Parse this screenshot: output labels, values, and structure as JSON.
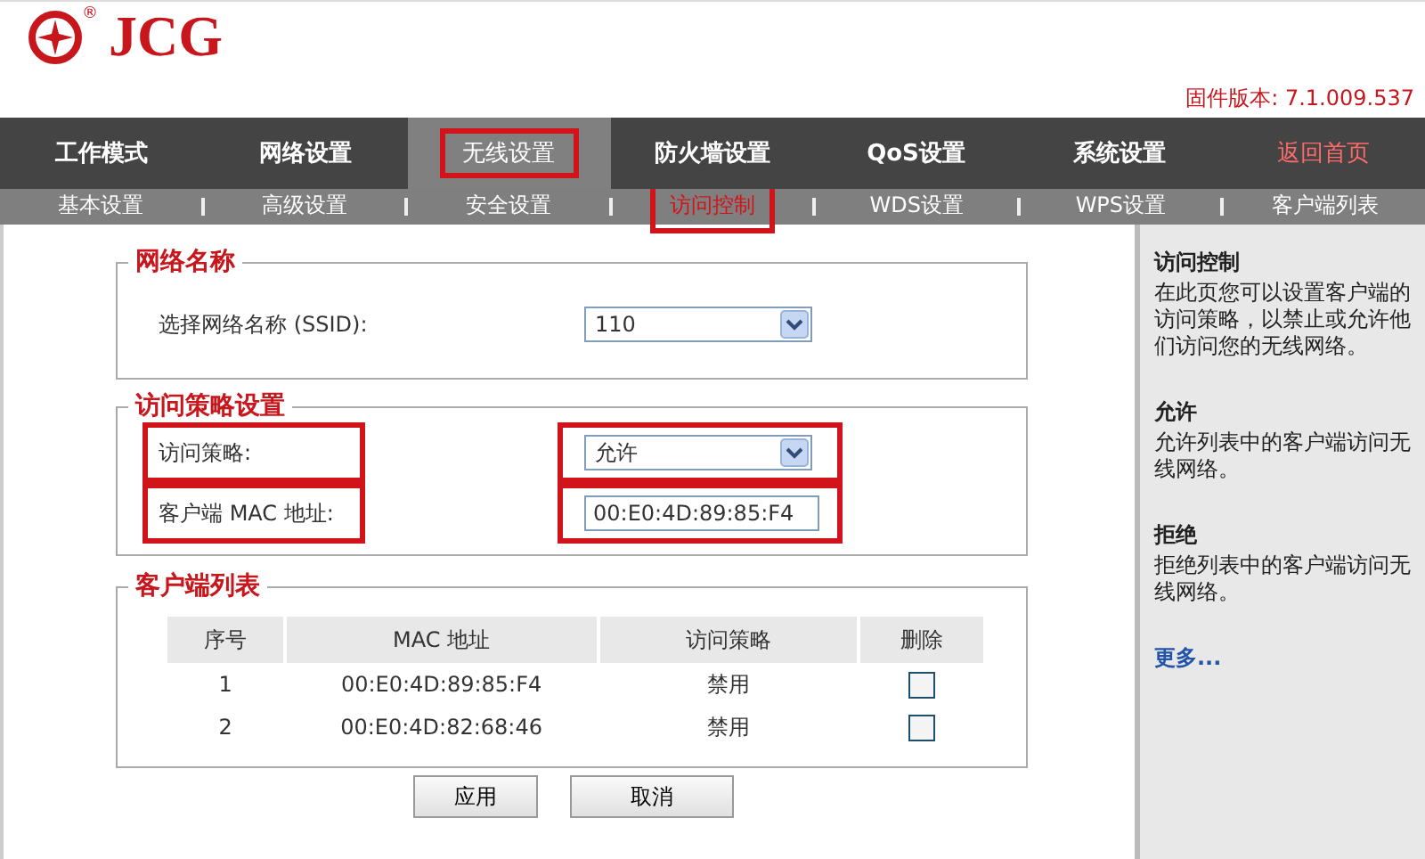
{
  "header": {
    "logo": "JCG",
    "registered": "®",
    "firmware": "固件版本: 7.1.009.537"
  },
  "main_nav": [
    {
      "label": "工作模式",
      "selected": false,
      "highlighted": false
    },
    {
      "label": "网络设置",
      "selected": false,
      "highlighted": false
    },
    {
      "label": "无线设置",
      "selected": true,
      "highlighted": true
    },
    {
      "label": "防火墙设置",
      "selected": false,
      "highlighted": false
    },
    {
      "label": "QoS设置",
      "selected": false,
      "highlighted": false
    },
    {
      "label": "系统设置",
      "selected": false,
      "highlighted": false
    }
  ],
  "home_link": "返回首页",
  "sub_nav": [
    {
      "label": "基本设置",
      "selected": false,
      "highlighted": false
    },
    {
      "label": "高级设置",
      "selected": false,
      "highlighted": false
    },
    {
      "label": "安全设置",
      "selected": false,
      "highlighted": false
    },
    {
      "label": "访问控制",
      "selected": true,
      "highlighted": true
    },
    {
      "label": "WDS设置",
      "selected": false,
      "highlighted": false
    },
    {
      "label": "WPS设置",
      "selected": false,
      "highlighted": false
    },
    {
      "label": "客户端列表",
      "selected": false,
      "highlighted": false
    }
  ],
  "sections": [
    {
      "title": "网络名称",
      "fields": [
        {
          "label": "选择网络名称 (SSID):",
          "kind": "select",
          "value": "110",
          "highlighted": false
        }
      ]
    },
    {
      "title": "访问策略设置",
      "fields": [
        {
          "label": "访问策略:",
          "kind": "select",
          "value": "允许",
          "highlighted": true
        },
        {
          "label": "客户端 MAC 地址:",
          "kind": "text",
          "value": "00:E0:4D:89:85:F4",
          "highlighted": true
        }
      ]
    }
  ],
  "client_list": {
    "title": "客户端列表",
    "columns": [
      "序号",
      "MAC 地址",
      "访问策略",
      "删除"
    ],
    "rows": [
      {
        "index": "1",
        "mac": "00:E0:4D:89:85:F4",
        "policy": "禁用",
        "checked": false
      },
      {
        "index": "2",
        "mac": "00:E0:4D:82:68:46",
        "policy": "禁用",
        "checked": false
      }
    ]
  },
  "buttons": [
    "应用",
    "取消"
  ],
  "help": {
    "sections": [
      {
        "title": "访问控制",
        "text": "在此页您可以设置客户端的访问策略，以禁止或允许他们访问您的无线网络。"
      },
      {
        "title": "允许",
        "text": "允许列表中的客户端访问无线网络。"
      },
      {
        "title": "拒绝",
        "text": "拒绝列表中的客户端访问无线网络。"
      }
    ],
    "more_link": "更多..."
  }
}
